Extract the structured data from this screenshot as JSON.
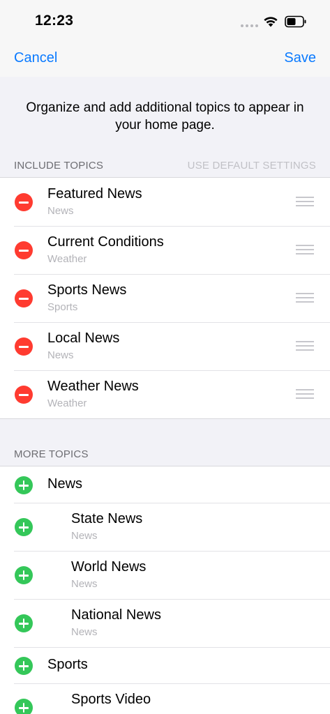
{
  "status_bar": {
    "time": "12:23"
  },
  "nav": {
    "cancel_label": "Cancel",
    "save_label": "Save"
  },
  "intro_text": "Organize and add additional topics to appear in your home page.",
  "include_section": {
    "header": "INCLUDE TOPICS",
    "default_settings_label": "USE DEFAULT SETTINGS",
    "items": [
      {
        "title": "Featured News",
        "subtitle": "News"
      },
      {
        "title": "Current Conditions",
        "subtitle": "Weather"
      },
      {
        "title": "Sports News",
        "subtitle": "Sports"
      },
      {
        "title": "Local News",
        "subtitle": "News"
      },
      {
        "title": "Weather News",
        "subtitle": "Weather"
      }
    ]
  },
  "more_section": {
    "header": "MORE TOPICS",
    "items": [
      {
        "title": "News",
        "subtitle": ""
      },
      {
        "title": "State News",
        "subtitle": "News"
      },
      {
        "title": "World News",
        "subtitle": "News"
      },
      {
        "title": "National News",
        "subtitle": "News"
      },
      {
        "title": "Sports",
        "subtitle": ""
      },
      {
        "title": "Sports Video",
        "subtitle": ""
      }
    ]
  },
  "colors": {
    "accent": "#0a7aff",
    "remove": "#ff3b30",
    "add": "#34c759"
  },
  "icons": [
    "wifi-icon",
    "battery-icon",
    "remove-icon",
    "add-icon",
    "drag-handle-icon"
  ]
}
